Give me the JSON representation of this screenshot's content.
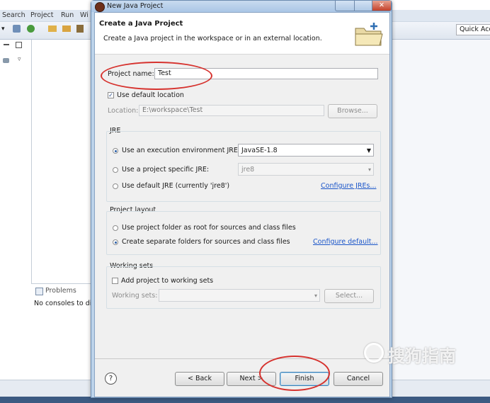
{
  "eclipse": {
    "menu": [
      "Search",
      "Project",
      "Run",
      "Wi"
    ],
    "quick_access": "Quick Acc",
    "problems_tab": "Problems",
    "console_text": "No consoles to di"
  },
  "dialog": {
    "title": "New Java Project",
    "close_glyph": "✕",
    "banner_title": "Create a Java Project",
    "banner_desc": "Create a Java project in the workspace or in an external location.",
    "project_name_label": "Project name:",
    "project_name_value": "Test",
    "use_default_location_label": "Use default location",
    "use_default_location_checked": true,
    "location_label": "Location:",
    "location_value": "E:\\workspace\\Test",
    "browse_label": "Browse...",
    "jre": {
      "group_label": "JRE",
      "option_env": "Use an execution environment JRE:",
      "env_value": "JavaSE-1.8",
      "option_specific": "Use a project specific JRE:",
      "specific_value": "jre8",
      "option_default": "Use default JRE (currently 'jre8')",
      "configure_link": "Configure JREs..."
    },
    "layout": {
      "group_label": "Project layout",
      "option_root": "Use project folder as root for sources and class files",
      "option_separate": "Create separate folders for sources and class files",
      "configure_link": "Configure default..."
    },
    "working_sets": {
      "group_label": "Working sets",
      "add_label": "Add project to working sets",
      "sets_label": "Working sets:",
      "select_label": "Select..."
    },
    "buttons": {
      "help": "?",
      "back": "< Back",
      "next": "Next >",
      "finish": "Finish",
      "cancel": "Cancel"
    }
  },
  "watermark": "搜狗指南"
}
